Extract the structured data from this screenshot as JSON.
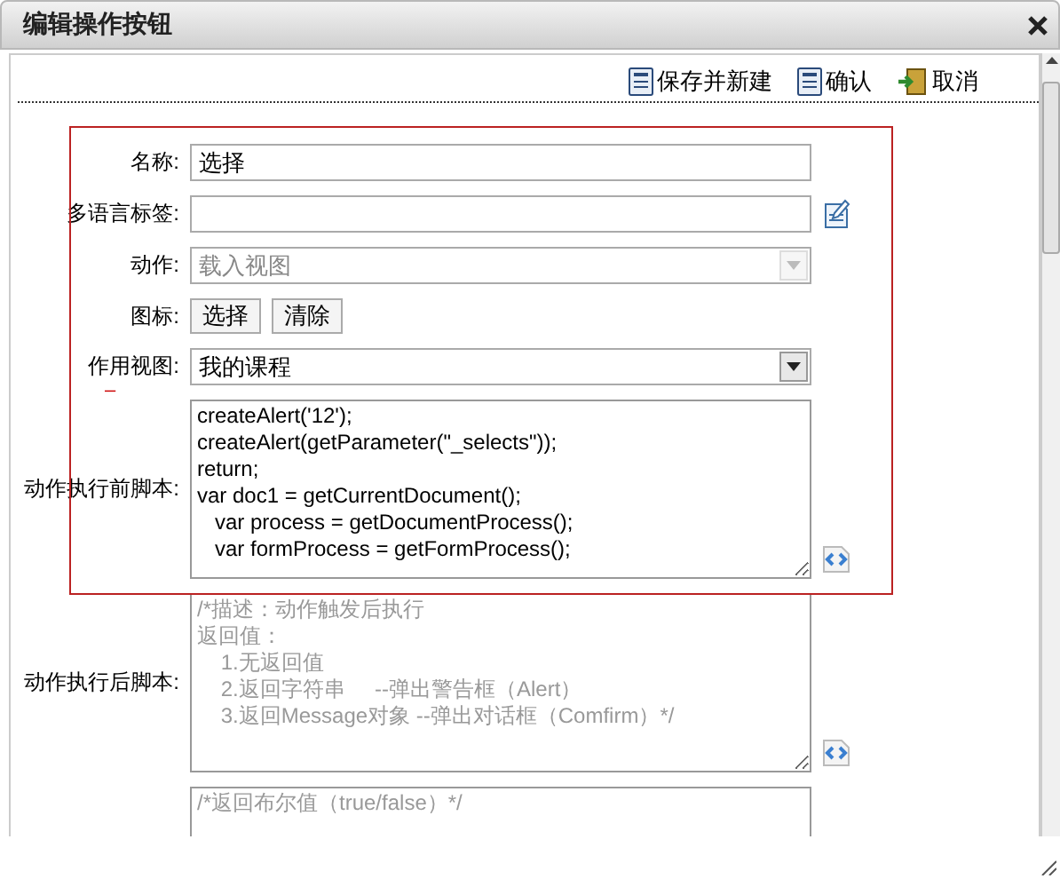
{
  "dialog": {
    "title": "编辑操作按钮"
  },
  "toolbar": [
    {
      "kind": "save",
      "label": "保存并新建"
    },
    {
      "kind": "save",
      "label": "确认"
    },
    {
      "kind": "exit",
      "label": "取消"
    }
  ],
  "fields": [
    {
      "kind": "text",
      "label": "名称:",
      "value": "选择"
    },
    {
      "kind": "text_with_icon",
      "label": "多语言标签:"
    },
    {
      "kind": "select",
      "label": "动作:",
      "value": "载入视图",
      "disabled": true
    },
    {
      "kind": "buttons",
      "label": "图标:",
      "buttons": [
        "选择",
        "清除"
      ]
    },
    {
      "kind": "select",
      "label": "作用视图:",
      "value": "我的课程",
      "disabled": false,
      "note": "–"
    },
    {
      "kind": "script",
      "label": "动作执行前脚本:",
      "lines": [
        "createAlert('12');",
        "createAlert(getParameter(\"_selects\"));",
        "return;",
        "var doc1 = getCurrentDocument();",
        "   var process = getDocumentProcess();",
        "   var formProcess = getFormProcess();"
      ]
    },
    {
      "kind": "script",
      "label": "动作执行后脚本:",
      "placeholder_lines": [
        "/*描述：动作触发后执行",
        "返回值：",
        "    1.无返回值",
        "    2.返回字符串     --弹出警告框（Alert）",
        "    3.返回Message对象 --弹出对话框（Comfirm）*/"
      ]
    },
    {
      "kind": "script_short",
      "placeholder_lines": [
        "/*返回布尔值（true/false）*/"
      ]
    }
  ]
}
